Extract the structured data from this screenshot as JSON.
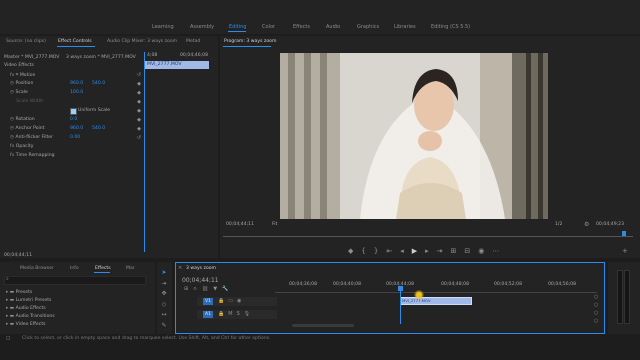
{
  "workspaces": [
    "Learning",
    "Assembly",
    "Editing",
    "Color",
    "Effects",
    "Audio",
    "Graphics",
    "Libraries",
    "Editing (CS 5.5)"
  ],
  "active_workspace": "Editing",
  "source_tabs": {
    "source": "Source: (no clips)",
    "effect_controls": "Effect Controls",
    "mixer": "Audio Clip Mixer: 3 ways zoom",
    "metadata": "Metad"
  },
  "effect_controls": {
    "master": "Master * MVI_2777.MOV",
    "sequence": "3 ways zoom * MVI_2777.MOV",
    "video_effects": "Video Effects",
    "motion": "Motion",
    "position_label": "Position",
    "position_x": "960.0",
    "position_y": "540.0",
    "scale_label": "Scale",
    "scale_value": "100.0",
    "scale_width_label": "Scale Width",
    "uniform_scale": "Uniform Scale",
    "rotation_label": "Rotation",
    "rotation_value": "0.0",
    "anchor_label": "Anchor Point",
    "anchor_x": "960.0",
    "anchor_y": "540.0",
    "antiflicker_label": "Anti-flicker Filter",
    "antiflicker_value": "0.00",
    "opacity": "Opacity",
    "time_remap": "Time Remapping",
    "mini_time1": "4;08",
    "mini_time2": "00;04;46;08",
    "mini_clip": "MVI_2777.MOV",
    "timecode": "00;04;44;11"
  },
  "program": {
    "title": "Program: 3 ways zoom",
    "timecode": "00;04;44;11",
    "fit": "Fit",
    "ratio": "1/2",
    "duration": "00;04;49;23"
  },
  "project_tabs": [
    "Media Browser",
    "Info",
    "Effects",
    "Mar"
  ],
  "active_project_tab": "Effects",
  "effects_list": [
    "Presets",
    "Lumetri Presets",
    "Audio Effects",
    "Audio Transitions",
    "Video Effects"
  ],
  "timeline": {
    "title": "3 ways zoom",
    "timecode": "00;04;44;11",
    "ruler": [
      "00;04;36;08",
      "00;04;40;08",
      "00;04;44;08",
      "00;04;48;08",
      "00;04;52;08",
      "00;04;56;08"
    ],
    "track_v1": "V1",
    "track_a1": "A1",
    "clip_label": "MVI_2777.MOV"
  },
  "status": "Click to select, or click in empty space and drag to marquee select. Use Shift, Alt, and Ctrl for other options.",
  "colors": {
    "accent": "#2d8ceb",
    "clip": "#a0b9e8",
    "playhead_marker": "#f0c020"
  }
}
